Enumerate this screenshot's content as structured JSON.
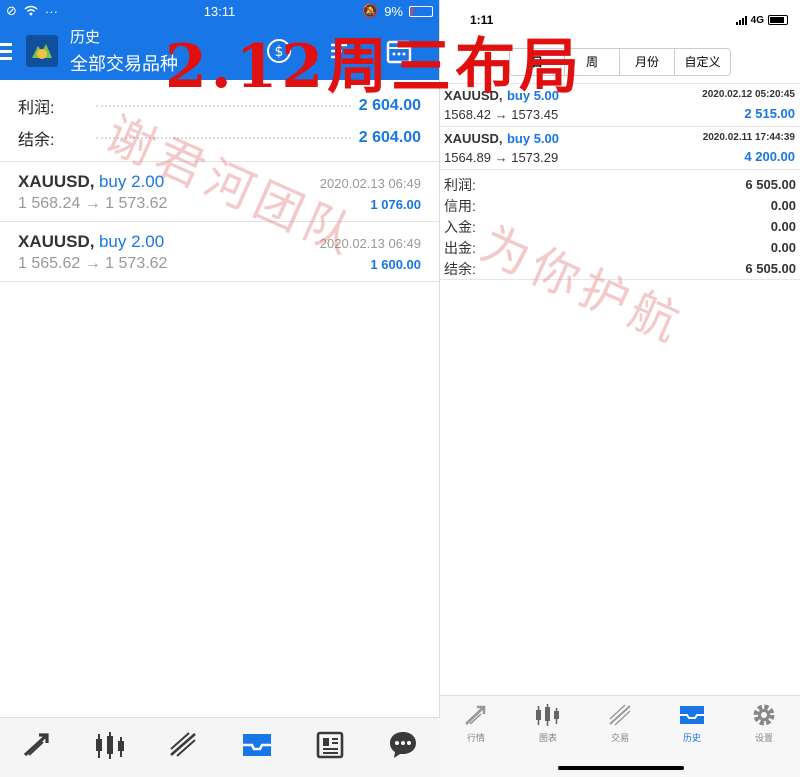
{
  "left": {
    "status": {
      "time": "13:11",
      "battery": "9%"
    },
    "appbar": {
      "title": "历史",
      "subtitle": "全部交易品种"
    },
    "summary": [
      {
        "label": "利润:",
        "value": "2 604.00"
      },
      {
        "label": "结余:",
        "value": "2 604.00"
      }
    ],
    "deals": [
      {
        "symbol": "XAUUSD,",
        "side": "buy 2.00",
        "prices": "1 568.24 → 1 573.62",
        "date": "2020.02.13 06:49",
        "profit": "1 076.00"
      },
      {
        "symbol": "XAUUSD,",
        "side": "buy 2.00",
        "prices": "1 565.62 → 1 573.62",
        "date": "2020.02.13 06:49",
        "profit": "1 600.00"
      }
    ],
    "nav_icons": [
      "trade-arrows-icon",
      "candlestick-icon",
      "chart-trend-icon",
      "inbox-history-icon",
      "news-icon",
      "chat-icon"
    ]
  },
  "right": {
    "status": {
      "time": "1:11",
      "network": "4G"
    },
    "segments": [
      "日",
      "周",
      "月份",
      "自定义"
    ],
    "deals": [
      {
        "symbol": "XAUUSD,",
        "side": "buy 5.00",
        "prices": "1568.42 → 1573.45",
        "date": "2020.02.12 05:20:45",
        "profit": "2 515.00"
      },
      {
        "symbol": "XAUUSD,",
        "side": "buy 5.00",
        "prices": "1564.89 → 1573.29",
        "date": "2020.02.11 17:44:39",
        "profit": "4 200.00"
      }
    ],
    "summary": [
      {
        "label": "利润:",
        "value": "6 505.00"
      },
      {
        "label": "信用:",
        "value": "0.00"
      },
      {
        "label": "入金:",
        "value": "0.00"
      },
      {
        "label": "出金:",
        "value": "0.00"
      },
      {
        "label": "结余:",
        "value": "6 505.00"
      }
    ],
    "tabs": [
      "行情",
      "图表",
      "交易",
      "历史",
      "设置"
    ]
  },
  "overlay": {
    "headline": "2.12周三布局",
    "watermark_a": "谢君河团队",
    "watermark_b": "为你护航"
  },
  "colors": {
    "accent": "#1976e6",
    "headline": "#e01010",
    "watermark": "#dc6464"
  }
}
